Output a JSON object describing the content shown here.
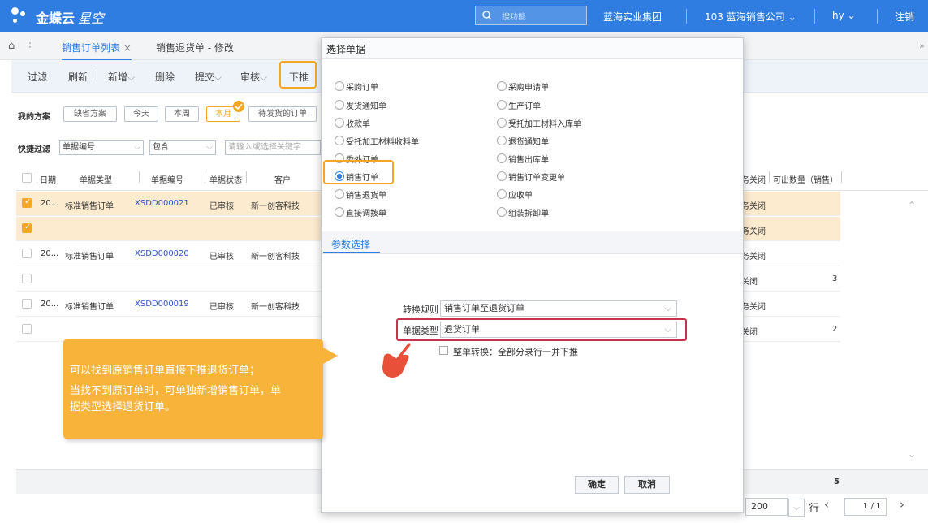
{
  "app": {
    "brand": "金蝶云",
    "brand_sub": "星空",
    "search_placeholder": "搜功能",
    "org": "蓝海实业集团",
    "company": "103 蓝海销售公司",
    "user": "hy",
    "logout": "注销"
  },
  "tabs": [
    {
      "label": "销售订单列表"
    },
    {
      "label": "销售退货单 - 修改"
    }
  ],
  "toolbar": {
    "filter": "过滤",
    "refresh": "刷新",
    "add": "新增",
    "delete": "删除",
    "submit": "提交",
    "audit": "审核",
    "push": "下推"
  },
  "scheme": {
    "label": "我的方案",
    "chips": [
      "缺省方案",
      "今天",
      "本周",
      "本月",
      "待发货的订单"
    ]
  },
  "quick_filter": {
    "label": "快捷过滤",
    "field": "单据编号",
    "op": "包含",
    "placeholder": "请输入或选择关键字"
  },
  "grid": {
    "headers": [
      "日期",
      "单据类型",
      "单据编号",
      "单据状态",
      "客户"
    ],
    "right_headers": {
      "close": "务关闭",
      "qty": "可出数量（销售）"
    },
    "rows": [
      {
        "checked": true,
        "date": "20...",
        "type": "标准销售订单",
        "no": "XSDD000021",
        "status": "已审核",
        "customer": "新一创客科技",
        "close": "务关闭",
        "qty": ""
      },
      {
        "checked": true,
        "date": "",
        "type": "",
        "no": "",
        "status": "",
        "customer": "",
        "close": "务关闭",
        "qty": ""
      },
      {
        "checked": false,
        "date": "20...",
        "type": "标准销售订单",
        "no": "XSDD000020",
        "status": "已审核",
        "customer": "新一创客科技",
        "close": "务关闭",
        "qty": ""
      },
      {
        "checked": false,
        "date": "",
        "type": "",
        "no": "",
        "status": "",
        "customer": "",
        "close": "关闭",
        "qty": "3"
      },
      {
        "checked": false,
        "date": "20...",
        "type": "标准销售订单",
        "no": "XSDD000019",
        "status": "已审核",
        "customer": "新一创客科技",
        "close": "务关闭",
        "qty": ""
      },
      {
        "checked": false,
        "date": "",
        "type": "",
        "no": "",
        "status": "",
        "customer": "",
        "close": "关闭",
        "qty": "2"
      }
    ],
    "total": "5"
  },
  "dialog": {
    "title": "选择单据",
    "left_options": [
      "采购订单",
      "发货通知单",
      "收款单",
      "受托加工材料收料单",
      "委外订单",
      "销售订单",
      "销售退货单",
      "直接调拨单"
    ],
    "right_options": [
      "采购申请单",
      "生产订单",
      "受托加工材料入库单",
      "退货通知单",
      "销售出库单",
      "销售订单变更单",
      "应收单",
      "组装拆卸单"
    ],
    "param_tab": "参数选择",
    "rule_label": "转换规则",
    "rule_value": "销售订单至退货订单",
    "type_label": "单据类型",
    "type_value": "退货订单",
    "whole_label": "整单转换：全部分录行一并下推",
    "ok": "确定",
    "cancel": "取消"
  },
  "callout": {
    "line1": "可以找到原销售订单直接下推退货订单；",
    "line2": "当找不到原订单时，可单独新增销售订单，单",
    "line3": "据类型选择退货订单。"
  },
  "pager": {
    "page_size": "200",
    "row_label": "行",
    "page": "1",
    "page_total": "/ 1"
  }
}
